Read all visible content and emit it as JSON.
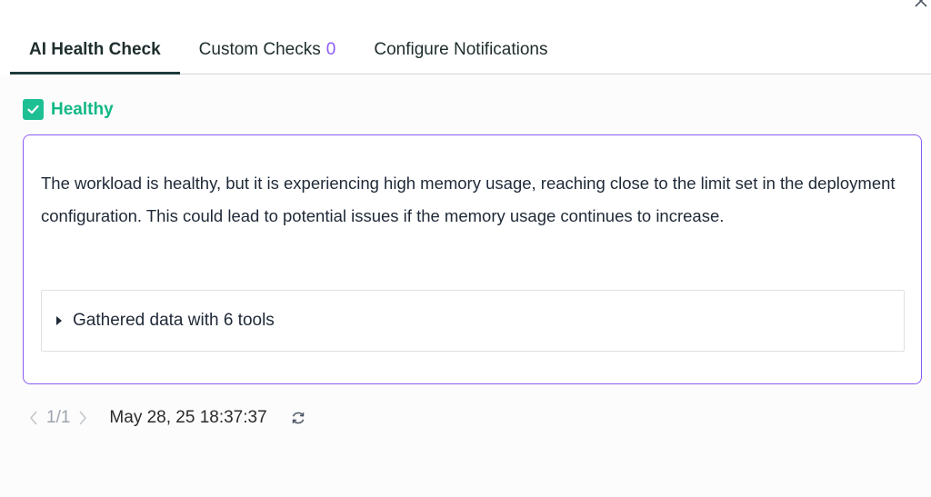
{
  "window": {
    "close_icon": "close-icon"
  },
  "tabs": [
    {
      "label": "AI Health Check",
      "active": true
    },
    {
      "label": "Custom Checks",
      "count": "0"
    },
    {
      "label": "Configure Notifications"
    }
  ],
  "status": {
    "icon": "checkbox-checked-icon",
    "label": "Healthy",
    "color": "#12b886"
  },
  "card": {
    "border_color": "#8b5cf6",
    "summary": "The workload is healthy, but it is experiencing high memory usage, reaching close to the limit set in the deployment configuration. This could lead to potential issues if the memory usage continues to increase.",
    "tools_label": "Gathered data with 6 tools"
  },
  "pager": {
    "page": "1/1",
    "timestamp": "May 28, 25 18:37:37",
    "refresh_icon": "refresh-icon"
  }
}
